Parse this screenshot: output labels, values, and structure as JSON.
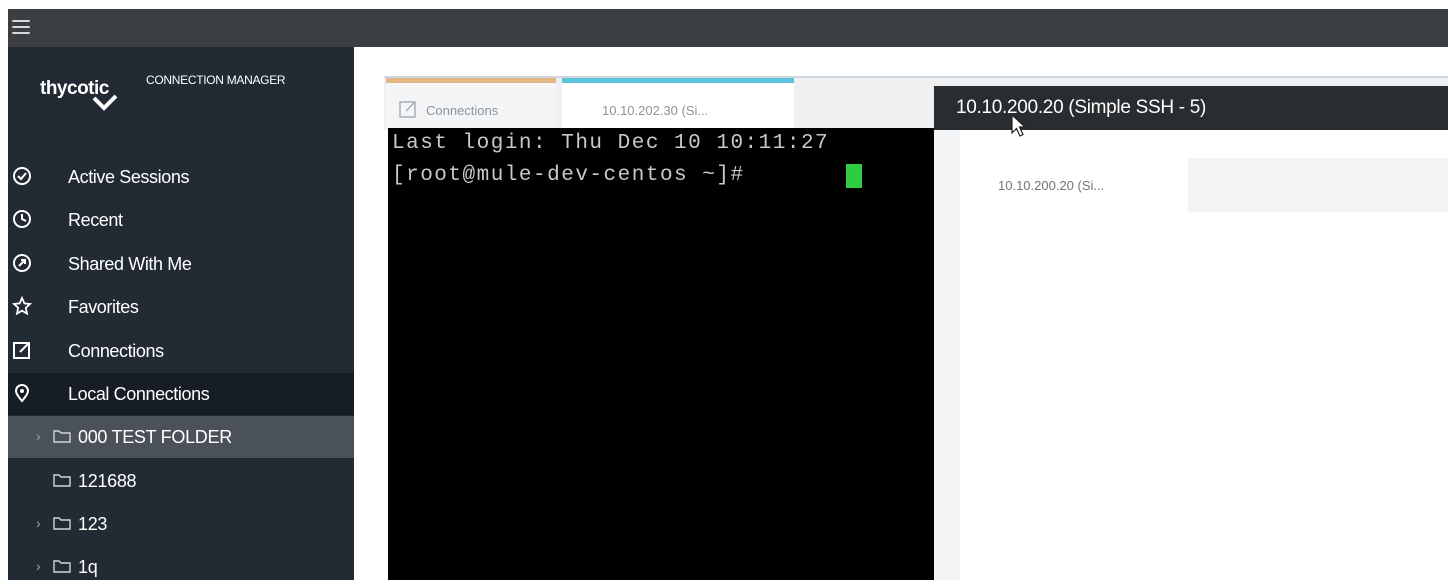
{
  "app": {
    "logo_text": "thycotic",
    "logo_subtitle": "CONNECTION MANAGER"
  },
  "sidebar": {
    "nav_items": [
      {
        "label": "Active Sessions",
        "icon": "check-circle-icon"
      },
      {
        "label": "Recent",
        "icon": "clock-icon"
      },
      {
        "label": "Shared With Me",
        "icon": "shared-icon"
      },
      {
        "label": "Favorites",
        "icon": "star-icon"
      },
      {
        "label": "Connections",
        "icon": "edit-square-icon"
      },
      {
        "label": "Local Connections",
        "icon": "location-pin-icon"
      }
    ],
    "folders": [
      {
        "label": "000 TEST FOLDER",
        "has_children": true,
        "selected": true
      },
      {
        "label": "121688",
        "has_children": false,
        "selected": false
      },
      {
        "label": "123",
        "has_children": true,
        "selected": false
      },
      {
        "label": "1q",
        "has_children": true,
        "selected": false
      }
    ]
  },
  "tabs": [
    {
      "label": "Connections",
      "icon": "edit-square-icon",
      "accent": "#e1b682"
    },
    {
      "label": "10.10.202.30 (Si...",
      "accent": "#5cc3dc"
    }
  ],
  "terminal": {
    "lines": [
      "Last login: Thu Dec 10 10:11:27",
      "[root@mule-dev-centos ~]# "
    ],
    "cursor_color": "#2ecc40"
  },
  "popup": {
    "title": "10.10.200.20 (Simple SSH - 5)",
    "tab_label": "10.10.200.20 (Si..."
  },
  "colors": {
    "sidebar_bg": "#222a33",
    "topbar_bg": "#3c3f42",
    "selected_folder_bg": "#4b5158"
  }
}
